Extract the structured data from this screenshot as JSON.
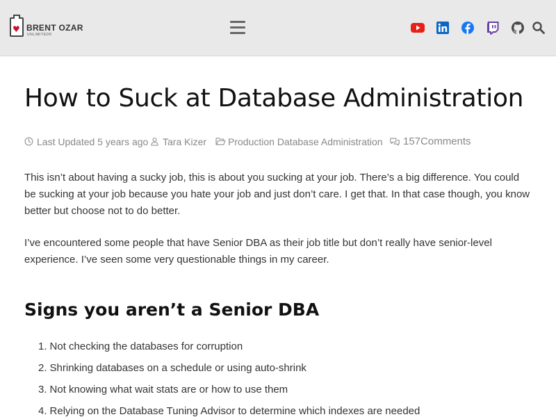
{
  "header": {
    "logo_name": "BRENT OZAR",
    "logo_sub": "UNLIMITED®",
    "menu_icon": "hamburger-menu-icon",
    "social": [
      {
        "name": "youtube-icon",
        "color": "#e62117"
      },
      {
        "name": "linkedin-icon",
        "color": "#0a66c2"
      },
      {
        "name": "facebook-icon",
        "color": "#1877f2"
      },
      {
        "name": "twitch-icon",
        "color": "#6441a5"
      },
      {
        "name": "github-icon",
        "color": "#444444"
      },
      {
        "name": "search-icon",
        "color": "#444444"
      }
    ]
  },
  "article": {
    "title": "How to Suck at Database Administration",
    "meta": {
      "updated": "Last Updated 5 years ago",
      "author": "Tara Kizer",
      "category": "Production Database Administration",
      "comments": "157Comments"
    },
    "paragraphs": [
      "This isn’t about having a sucky job, this is about you sucking at your job. There’s a big difference. You could be sucking at your job because you hate your job and just don’t care. I get that. In that case though, you know better but choose not to do better.",
      "I’ve encountered some people that have Senior DBA as their job title but don’t really have senior-level experience. I’ve seen some very questionable things in my career."
    ],
    "section_heading": "Signs you aren’t a Senior DBA",
    "list": [
      {
        "num": "1.",
        "text": "Not checking the databases for corruption"
      },
      {
        "num": "2.",
        "text": "Shrinking databases on a schedule or using auto-shrink"
      },
      {
        "num": "3.",
        "text": "Not knowing what wait stats are or how to use them"
      },
      {
        "num": "4.",
        "text": "Relying on the Database Tuning Advisor to determine which indexes are needed"
      }
    ]
  }
}
